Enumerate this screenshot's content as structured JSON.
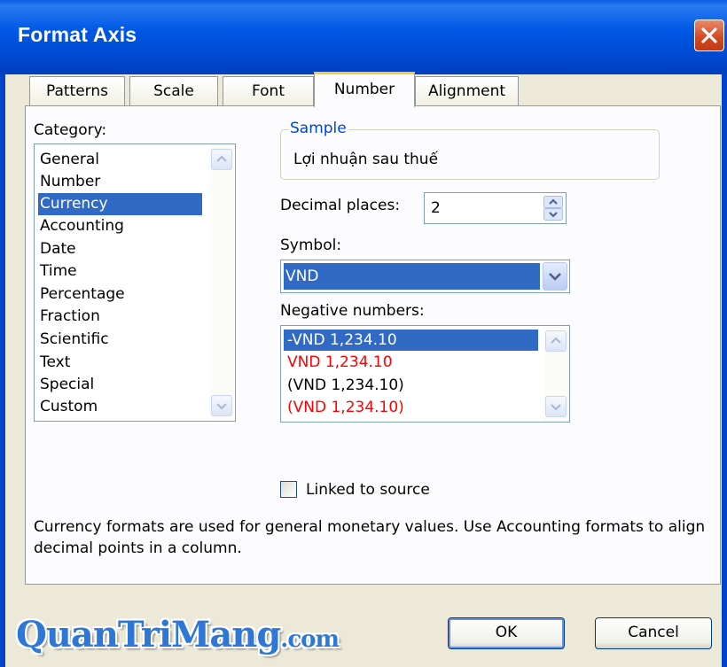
{
  "window": {
    "title": "Format Axis",
    "close_icon": "close-icon"
  },
  "tabs": [
    {
      "label": "Patterns"
    },
    {
      "label": "Scale"
    },
    {
      "label": "Font"
    },
    {
      "label": "Number",
      "active": true
    },
    {
      "label": "Alignment"
    }
  ],
  "category": {
    "label": "Category:",
    "items": [
      "General",
      "Number",
      "Currency",
      "Accounting",
      "Date",
      "Time",
      "Percentage",
      "Fraction",
      "Scientific",
      "Text",
      "Special",
      "Custom"
    ],
    "selected": "Currency"
  },
  "sample": {
    "legend": "Sample",
    "text": "Lợi nhuận sau thuế"
  },
  "decimal_places": {
    "label": "Decimal places:",
    "value": "2"
  },
  "symbol": {
    "label": "Symbol:",
    "value": "VND"
  },
  "negative_numbers": {
    "label": "Negative numbers:",
    "items": [
      {
        "text": "-VND 1,234.10",
        "color": "#000000",
        "selected": true
      },
      {
        "text": "VND 1,234.10",
        "color": "#FF0000"
      },
      {
        "text": "(VND 1,234.10)",
        "color": "#000000"
      },
      {
        "text": "(VND 1,234.10)",
        "color": "#FF0000"
      }
    ]
  },
  "linked_to_source": {
    "label": "Linked to source",
    "checked": false
  },
  "description": "Currency formats are used for general monetary values.  Use Accounting formats to align decimal points in a column.",
  "buttons": {
    "ok": "OK",
    "cancel": "Cancel"
  },
  "watermark": {
    "main": "QuanTriMang",
    "suffix": ".com"
  },
  "colors": {
    "titlebar": "#0058E6",
    "selection": "#316AC5",
    "legend": "#0046D5",
    "negative_red": "#FF0000",
    "dialog_bg": "#ECE9D8"
  }
}
